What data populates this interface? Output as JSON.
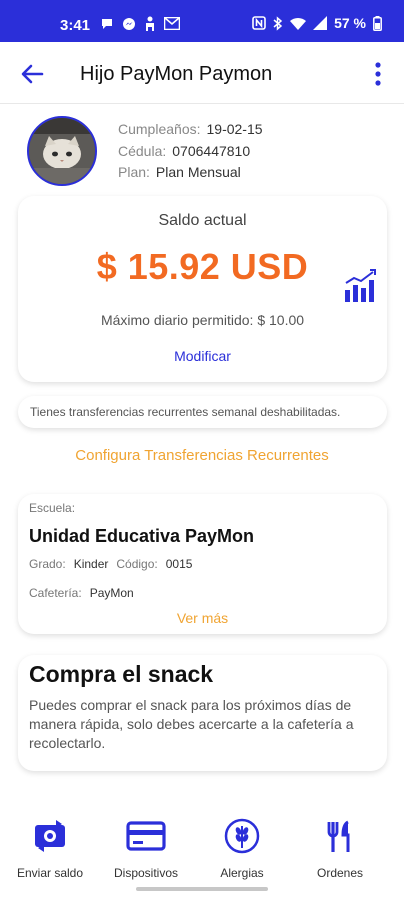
{
  "status_bar": {
    "time": "3:41",
    "battery": "57 %",
    "left_icons": [
      "chat-bubble-icon",
      "messenger-icon",
      "person-icon",
      "gmail-icon"
    ],
    "right_icons": [
      "nfc-icon",
      "bluetooth-icon",
      "wifi-icon",
      "signal-icon",
      "battery-icon"
    ]
  },
  "header": {
    "title": "Hijo PayMon Paymon",
    "back_icon": "arrow-left-icon",
    "menu_icon": "more-vertical-icon"
  },
  "profile": {
    "birthday_label": "Cumpleaños:",
    "birthday": "19-02-15",
    "id_label": "Cédula:",
    "id": "0706447810",
    "plan_label": "Plan:",
    "plan": "Plan Mensual"
  },
  "balance": {
    "label": "Saldo actual",
    "amount": "$ 15.92 USD",
    "max_daily": "Máximo diario permitido: $ 10.00",
    "modify": "Modificar",
    "chart_icon": "bar-chart-icon"
  },
  "transfers": {
    "notice": "Tienes transferencias recurrentes semanal deshabilitadas.",
    "configure": "Configura Transferencias Recurrentes"
  },
  "school": {
    "label": "Escuela:",
    "name": "Unidad Educativa PayMon",
    "grade_label": "Grado:",
    "grade": "Kinder",
    "code_label": "Código:",
    "code": "0015",
    "cafeteria_label": "Cafetería:",
    "cafeteria": "PayMon",
    "see_more": "Ver más"
  },
  "snack": {
    "title": "Compra el snack",
    "description": "Puedes comprar el snack para los próximos días de manera rápida, solo debes acercarte a la cafetería a recolectarlo."
  },
  "bottom_nav": {
    "items": [
      {
        "label": "Enviar saldo",
        "icon": "send-money-icon"
      },
      {
        "label": "Dispositivos",
        "icon": "card-icon"
      },
      {
        "label": "Alergias",
        "icon": "wheat-icon"
      },
      {
        "label": "Ordenes",
        "icon": "utensils-icon"
      }
    ]
  },
  "colors": {
    "primary": "#2b2fd9",
    "accent_orange": "#f26a22",
    "link_orange": "#f0a432"
  }
}
